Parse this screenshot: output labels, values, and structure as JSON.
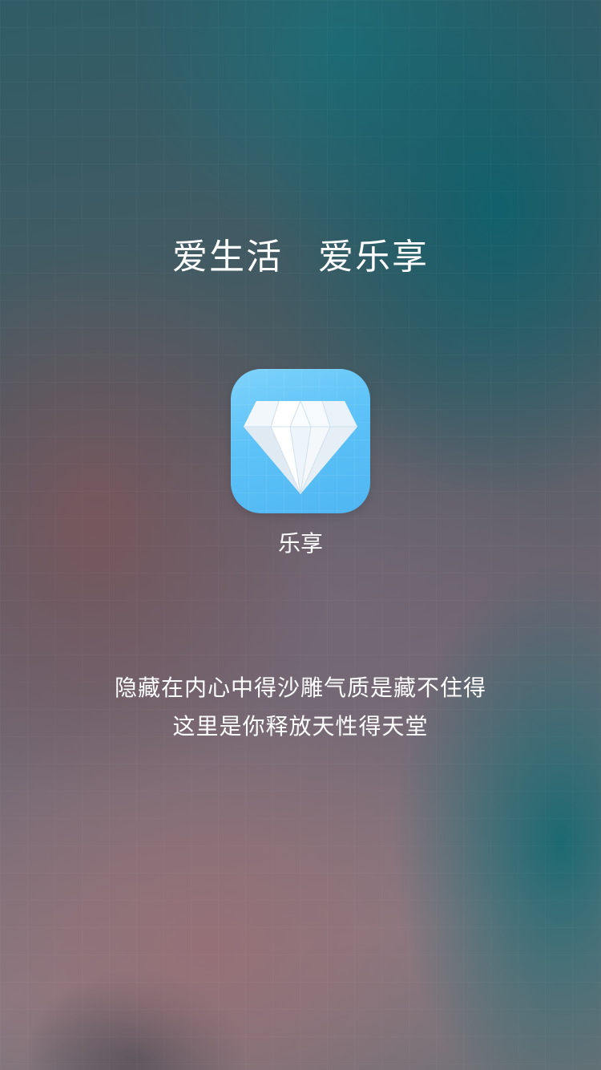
{
  "splash": {
    "slogan_left": "爱生活",
    "slogan_right": "爱乐享",
    "app": {
      "name": "乐享",
      "icon": "diamond-icon",
      "icon_color": "#5cc2f7"
    },
    "tagline": [
      "隐藏在内心中得沙雕气质是藏不住得",
      "这里是你释放天性得天堂"
    ]
  }
}
